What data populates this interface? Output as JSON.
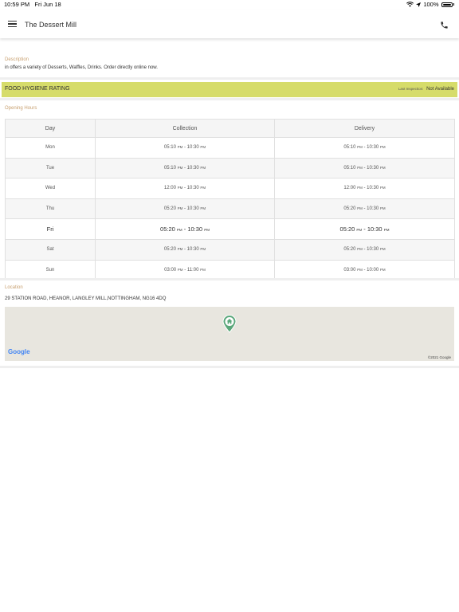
{
  "status_bar": {
    "time": "10:59 PM",
    "date": "Fri Jun 18",
    "battery": "100%"
  },
  "header": {
    "title": "The Dessert Mill",
    "menu_icon": "hamburger-menu-icon",
    "phone_icon": "phone-icon"
  },
  "description": {
    "label": "Description",
    "text": "in  offers a variety of  Desserts, Waffles, Drinks. Order directly online now."
  },
  "hygiene": {
    "title": "FOOD HYGIENE RATING",
    "last_inspection_label": "Last Inspection:",
    "last_inspection_value": "Not Available"
  },
  "opening_hours": {
    "label": "Opening Hours",
    "headers": [
      "Day",
      "Collection",
      "Delivery"
    ],
    "rows": [
      {
        "day": "Mon",
        "col_start": "05:10",
        "col_start_ampm": "PM",
        "col_end": "10:30",
        "col_end_ampm": "PM",
        "del_start": "05:10",
        "del_start_ampm": "PM",
        "del_end": "10:30",
        "del_end_ampm": "PM"
      },
      {
        "day": "Tue",
        "col_start": "05:10",
        "col_start_ampm": "PM",
        "col_end": "10:30",
        "col_end_ampm": "PM",
        "del_start": "05:10",
        "del_start_ampm": "PM",
        "del_end": "10:30",
        "del_end_ampm": "PM"
      },
      {
        "day": "Wed",
        "col_start": "12:00",
        "col_start_ampm": "PM",
        "col_end": "10:30",
        "col_end_ampm": "PM",
        "del_start": "12:00",
        "del_start_ampm": "PM",
        "del_end": "10:30",
        "del_end_ampm": "PM"
      },
      {
        "day": "Thu",
        "col_start": "05:20",
        "col_start_ampm": "PM",
        "col_end": "10:30",
        "col_end_ampm": "PM",
        "del_start": "05:20",
        "del_start_ampm": "PM",
        "del_end": "10:30",
        "del_end_ampm": "PM"
      },
      {
        "day": "Fri",
        "col_start": "05:20",
        "col_start_ampm": "PM",
        "col_end": "10:30",
        "col_end_ampm": "PM",
        "del_start": "05:20",
        "del_start_ampm": "PM",
        "del_end": "10:30",
        "del_end_ampm": "PM"
      },
      {
        "day": "Sat",
        "col_start": "05:20",
        "col_start_ampm": "PM",
        "col_end": "10:30",
        "col_end_ampm": "PM",
        "del_start": "05:20",
        "del_start_ampm": "PM",
        "del_end": "10:30",
        "del_end_ampm": "PM"
      },
      {
        "day": "Sun",
        "col_start": "03:00",
        "col_start_ampm": "PM",
        "col_end": "11:00",
        "col_end_ampm": "PM",
        "del_start": "03:00",
        "del_start_ampm": "PM",
        "del_end": "10:00",
        "del_end_ampm": "PM"
      }
    ]
  },
  "location": {
    "label": "Location",
    "address": "29 STATION ROAD, HEANOR, LANGLEY MILL,NOTTINGHAM, NG16 4DQ",
    "google_logo": "Google",
    "map_copyright": "©2021 Google",
    "pin_icon": "home-map-pin-icon"
  },
  "colors": {
    "hygiene_bar": "#d6dc6a",
    "label_accent": "#c8a070",
    "map_pin": "#5aa77a"
  }
}
